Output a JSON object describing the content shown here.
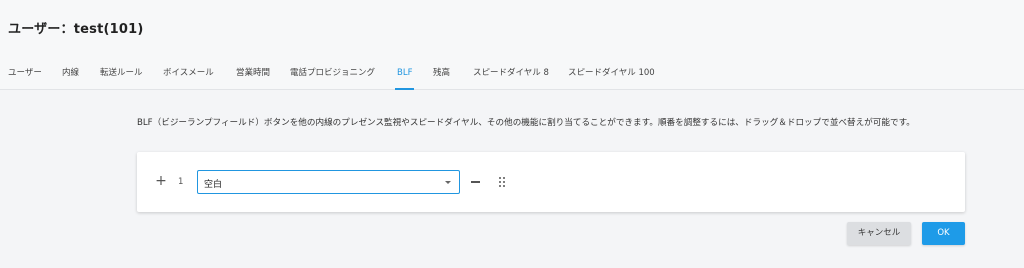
{
  "header": {
    "title": "ユーザー：test(101)"
  },
  "tabs": [
    {
      "label": "ユーザー",
      "active": false
    },
    {
      "label": "内線",
      "active": false
    },
    {
      "label": "転送ルール",
      "active": false
    },
    {
      "label": "ボイスメール",
      "active": false
    },
    {
      "label": "営業時間",
      "active": false
    },
    {
      "label": "電話プロビジョニング",
      "active": false
    },
    {
      "label": "BLF",
      "active": true
    },
    {
      "label": "残高",
      "active": false
    },
    {
      "label": "スピードダイヤル 8",
      "active": false
    },
    {
      "label": "スピードダイヤル 100",
      "active": false
    }
  ],
  "main": {
    "description": "BLF（ビジーランプフィールド）ボタンを他の内線のプレゼンス監視やスピードダイヤル、その他の機能に割り当てることができます。順番を調整するには、ドラッグ＆ドロップで並べ替えが可能です。",
    "rows": [
      {
        "index": "1",
        "value": "空白"
      }
    ],
    "icons": {
      "add": "plus-icon",
      "remove": "minus-icon",
      "drag": "drag-handle-icon",
      "dropdown": "caret-down-icon"
    }
  },
  "footer": {
    "cancel_label": "キャンセル",
    "ok_label": "OK"
  },
  "colors": {
    "accent": "#2196e0",
    "ok_button": "#1e9be8",
    "cancel_button": "#dcdee1",
    "background": "#f4f5f7"
  }
}
